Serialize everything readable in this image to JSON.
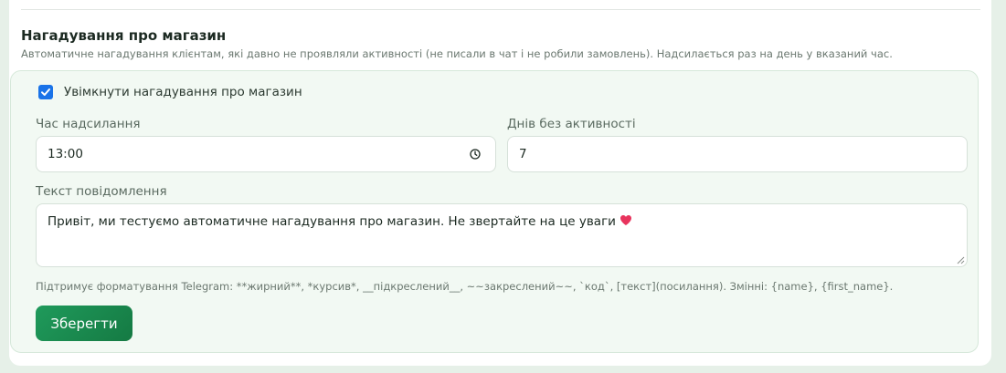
{
  "section": {
    "title": "Нагадування про магазин",
    "description": "Автоматичне нагадування клієнтам, які давно не проявляли активності (не писали в чат і не робили замовлень). Надсилається раз на день у вказаний час."
  },
  "toggle": {
    "label": "Увімкнути нагадування про магазин",
    "checked": true
  },
  "fields": {
    "send_time": {
      "label": "Час надсилання",
      "value": "13:00",
      "icon": "clock-icon"
    },
    "inactive_days": {
      "label": "Днів без активності",
      "value": "7"
    },
    "message": {
      "label": "Текст повідомлення",
      "value": "Привіт, ми тестуємо автоматичне нагадування про магазин. Не звертайте на це уваги",
      "emoji": "heart-icon"
    }
  },
  "format_hint": "Підтримує форматування Telegram: **жирний**, *курсив*, __підкреслений__, ~~закреслений~~, `код`, [текст](посилання). Змінні: {name}, {first_name}.",
  "actions": {
    "save_label": "Зберегти"
  },
  "colors": {
    "accent": "#1f9a5b",
    "checkbox": "#1a73e8",
    "heart": "#e8345d"
  }
}
